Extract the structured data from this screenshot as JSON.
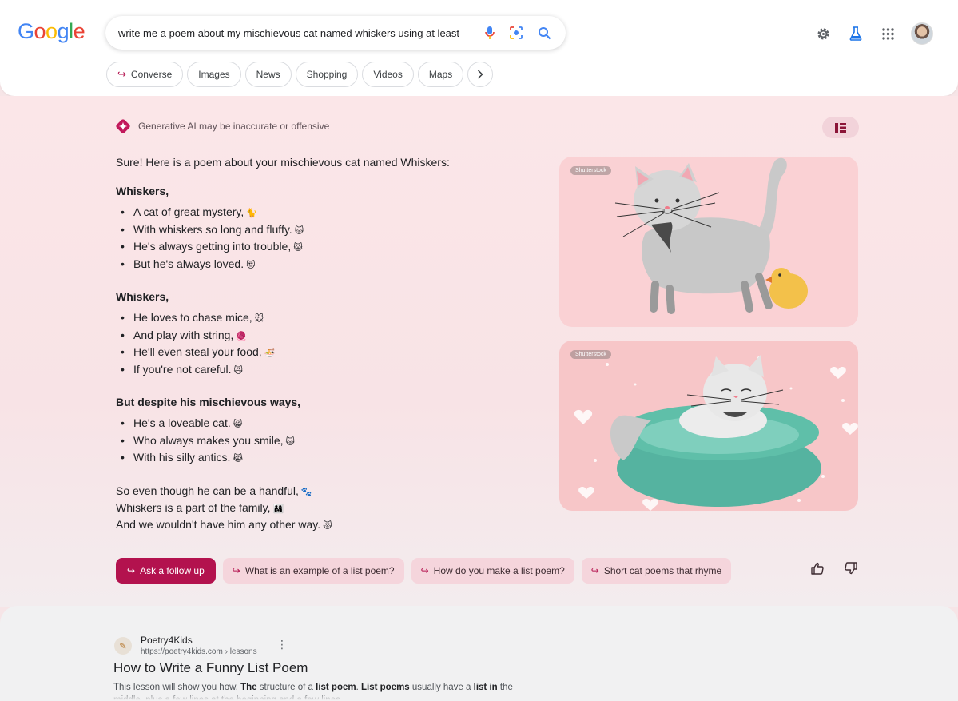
{
  "colors": {
    "accent": "#b3124e",
    "panel_bg": "#fbe6e8",
    "chip_bg": "#f5d5dc"
  },
  "header": {
    "logo": [
      "G",
      "o",
      "o",
      "g",
      "l",
      "e"
    ],
    "search_value": "write me a poem about my mischievous cat named whiskers using at least",
    "icons": [
      "mic-icon",
      "lens-icon",
      "search-icon",
      "gear-icon",
      "labs-flask-icon",
      "apps-grid-icon",
      "account-avatar"
    ]
  },
  "chips": [
    {
      "label": "Converse",
      "icon": "return-arrow-icon"
    },
    {
      "label": "Images"
    },
    {
      "label": "News"
    },
    {
      "label": "Shopping"
    },
    {
      "label": "Videos"
    },
    {
      "label": "Maps"
    }
  ],
  "ai": {
    "note": "Generative AI may be inaccurate or offensive",
    "intro": "Sure! Here is a poem about your mischievous cat named Whiskers:",
    "stanzas": [
      {
        "title": "Whiskers,",
        "lines": [
          {
            "text": "A cat of great mystery,",
            "emoji": "🐈"
          },
          {
            "text": "With whiskers so long and fluffy.",
            "emoji": "🐱"
          },
          {
            "text": "He's always getting into trouble,",
            "emoji": "😺"
          },
          {
            "text": "But he's always loved.",
            "emoji": "😻"
          }
        ]
      },
      {
        "title": "Whiskers,",
        "lines": [
          {
            "text": "He loves to chase mice,",
            "emoji": "🐭"
          },
          {
            "text": "And play with string,",
            "emoji": "🧶"
          },
          {
            "text": "He'll even steal your food,",
            "emoji": "🍜"
          },
          {
            "text": "If you're not careful.",
            "emoji": "🙀"
          }
        ]
      },
      {
        "title": "But despite his mischievous ways,",
        "lines": [
          {
            "text": "He's a loveable cat.",
            "emoji": "😸"
          },
          {
            "text": "Who always makes you smile,",
            "emoji": "🐱"
          },
          {
            "text": "With his silly antics.",
            "emoji": "😹"
          }
        ]
      }
    ],
    "closing": [
      {
        "text": "So even though he can be a handful,",
        "emoji": "🐾"
      },
      {
        "text": "Whiskers is a part of the family,",
        "emoji": "👨‍👩‍👧"
      },
      {
        "text": "And we wouldn't have him any other way.",
        "emoji": "😻"
      }
    ],
    "images": [
      {
        "badge": "Shutterstock",
        "alt": "cat-with-duck"
      },
      {
        "badge": "Shutterstock",
        "alt": "cat-in-bed"
      }
    ],
    "followups": [
      "Ask a follow up",
      "What is an example of a list poem?",
      "How do you make a list poem?",
      "Short cat poems that rhyme"
    ]
  },
  "result": {
    "site_name": "Poetry4Kids",
    "site_url": "https://poetry4kids.com › lessons",
    "title": "How to Write a Funny List Poem",
    "snippet_parts": [
      {
        "text": "This lesson will show you how. ",
        "bold": false
      },
      {
        "text": "The",
        "bold": true
      },
      {
        "text": " structure of a ",
        "bold": false
      },
      {
        "text": "list poem",
        "bold": true
      },
      {
        "text": ". ",
        "bold": false
      },
      {
        "text": "List poems",
        "bold": true
      },
      {
        "text": " usually have a ",
        "bold": false
      },
      {
        "text": "list in",
        "bold": true
      },
      {
        "text": " the middle, plus a few lines at the beginning and a few lines...",
        "bold": false
      }
    ]
  }
}
